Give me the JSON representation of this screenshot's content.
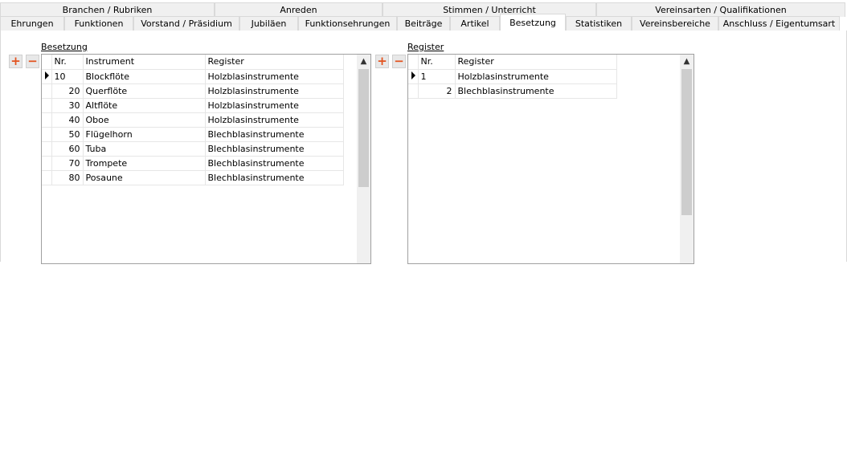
{
  "tabs_top": [
    "Branchen / Rubriken",
    "Anreden",
    "Stimmen / Unterricht",
    "Vereinsarten / Qualifikationen"
  ],
  "tabs_bottom": [
    "Ehrungen",
    "Funktionen",
    "Vorstand / Präsidium",
    "Jubiläen",
    "Funktionsehrungen",
    "Beiträge",
    "Artikel",
    "Besetzung",
    "Statistiken",
    "Vereinsbereiche",
    "Anschluss / Eigentumsart"
  ],
  "active_tab": "Besetzung",
  "besetzung": {
    "caption": "Besetzung",
    "add_glyph": "+",
    "remove_glyph": "−",
    "columns": [
      "Nr.",
      "Instrument",
      "Register"
    ],
    "rows": [
      {
        "nr": "10",
        "instrument": "Blockflöte",
        "register": "Holzblasinstrumente"
      },
      {
        "nr": "20",
        "instrument": "Querflöte",
        "register": "Holzblasinstrumente"
      },
      {
        "nr": "30",
        "instrument": "Altflöte",
        "register": "Holzblasinstrumente"
      },
      {
        "nr": "40",
        "instrument": "Oboe",
        "register": "Holzblasinstrumente"
      },
      {
        "nr": "50",
        "instrument": "Flügelhorn",
        "register": "Blechblasinstrumente"
      },
      {
        "nr": "60",
        "instrument": "Tuba",
        "register": "Blechblasinstrumente"
      },
      {
        "nr": "70",
        "instrument": "Trompete",
        "register": "Blechblasinstrumente"
      },
      {
        "nr": "80",
        "instrument": "Posaune",
        "register": "Blechblasinstrumente"
      }
    ]
  },
  "register": {
    "caption": "Register",
    "add_glyph": "+",
    "remove_glyph": "−",
    "columns": [
      "Nr.",
      "Register"
    ],
    "rows": [
      {
        "nr": "1",
        "register": "Holzblasinstrumente"
      },
      {
        "nr": "2",
        "register": "Blechblasinstrumente"
      }
    ]
  },
  "scroll_up_glyph": "▲"
}
